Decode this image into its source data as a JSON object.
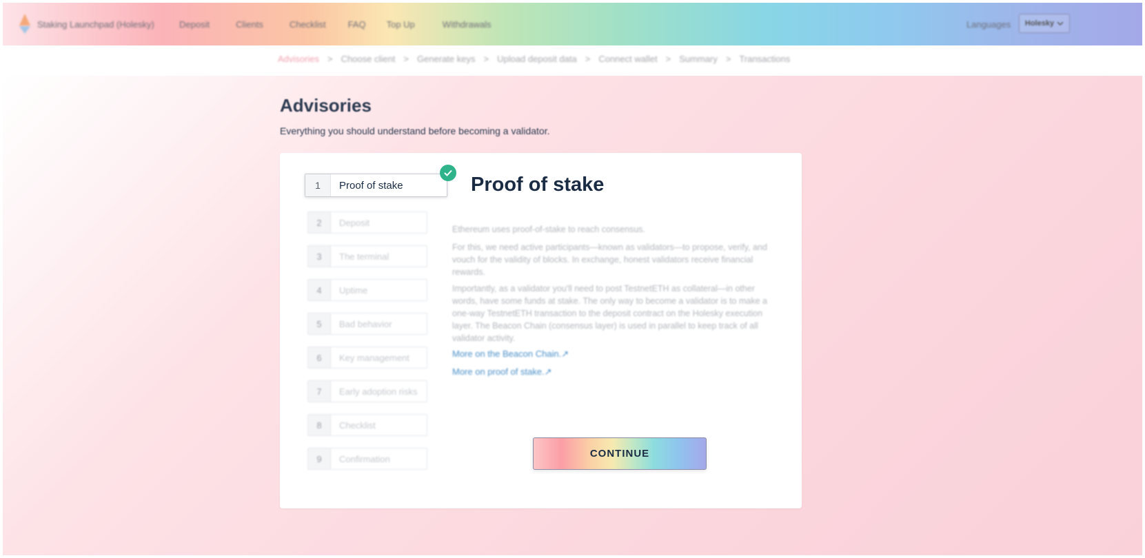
{
  "header": {
    "brand": "Staking Launchpad (Holesky)",
    "nav": [
      "Deposit",
      "Clients",
      "Checklist",
      "FAQ",
      "Top Up",
      "Withdrawals"
    ],
    "languages_label": "Languages",
    "network_label": "Holesky"
  },
  "breadcrumb": {
    "items": [
      "Advisories",
      "Choose client",
      "Generate keys",
      "Upload deposit data",
      "Connect wallet",
      "Summary",
      "Transactions"
    ],
    "separator": ">"
  },
  "main": {
    "title": "Advisories",
    "subtitle": "Everything you should understand before becoming a validator."
  },
  "steps": [
    {
      "num": "1",
      "label": "Proof of stake"
    },
    {
      "num": "2",
      "label": "Deposit"
    },
    {
      "num": "3",
      "label": "The terminal"
    },
    {
      "num": "4",
      "label": "Uptime"
    },
    {
      "num": "5",
      "label": "Bad behavior"
    },
    {
      "num": "6",
      "label": "Key management"
    },
    {
      "num": "7",
      "label": "Early adoption risks"
    },
    {
      "num": "8",
      "label": "Checklist"
    },
    {
      "num": "9",
      "label": "Confirmation"
    }
  ],
  "content": {
    "heading": "Proof of stake",
    "p1": "Ethereum uses proof-of-stake to reach consensus.",
    "p2": "For this, we need active participants—known as validators—to propose, verify, and vouch for the validity of blocks. In exchange, honest validators receive financial rewards.",
    "p3": "Importantly, as a validator you'll need to post TestnetETH as collateral—in other words, have some funds at stake. The only way to become a validator is to make a one-way TestnetETH transaction to the deposit contract on the Holesky execution layer. The Beacon Chain (consensus layer) is used in parallel to keep track of all validator activity.",
    "link1": "More on the Beacon Chain.↗",
    "link2": "More on proof of stake.↗",
    "continue_label": "CONTINUE"
  },
  "colors": {
    "accent_pink": "#f0a0ae",
    "check_green": "#2fb38a",
    "link_blue": "#4a90c8"
  }
}
